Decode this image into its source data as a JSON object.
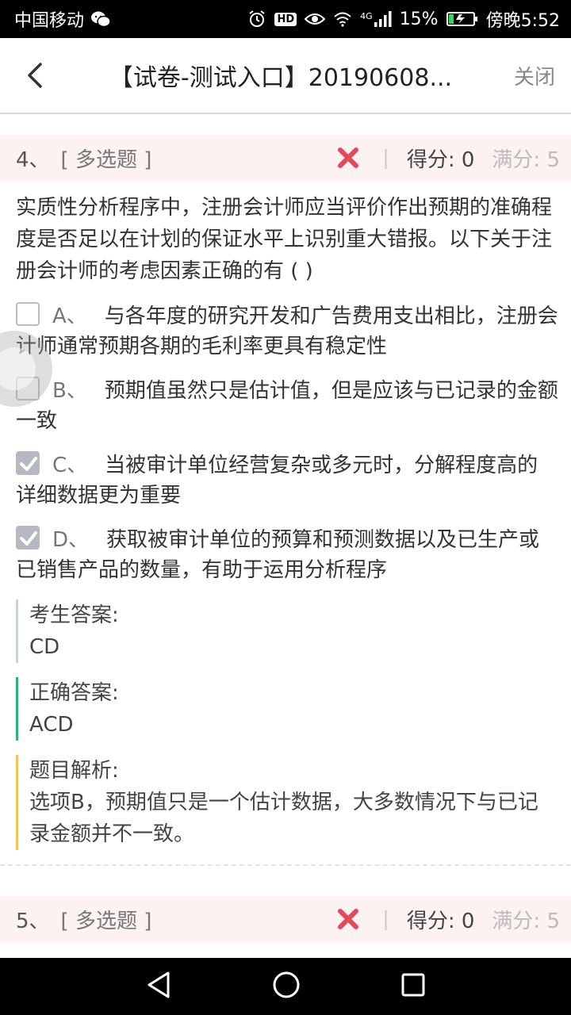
{
  "status_bar": {
    "carrier": "中国移动",
    "network": "4G",
    "battery": "15%",
    "time": "傍晚5:52",
    "hd_label": "HD"
  },
  "header": {
    "title": "【试卷-测试入口】20190608...",
    "close_label": "关闭"
  },
  "question": {
    "number": "4、",
    "type": "[ 多选题 ]",
    "separator": "|",
    "score": "得分: 0",
    "full": "满分: 5",
    "text": "实质性分析程序中，注册会计师应当评价作出预期的准确程度是否足以在计划的保证水平上识别重大错报。以下关于注册会计师的考虑因素正确的有 ( )",
    "options": [
      {
        "key": "A、",
        "text": "与各年度的研究开发和广告费用支出相比，注册会计师通常预期各期的毛利率更具有稳定性",
        "checked": false
      },
      {
        "key": "B、",
        "text": "预期值虽然只是估计值，但是应该与已记录的金额一致",
        "checked": false
      },
      {
        "key": "C、",
        "text": "当被审计单位经营复杂或多元时，分解程度高的详细数据更为重要",
        "checked": true
      },
      {
        "key": "D、",
        "text": "获取被审计单位的预算和预测数据以及已生产或已销售产品的数量，有助于运用分析程序",
        "checked": true
      }
    ],
    "student_answer_label": "考生答案:",
    "student_answer": "CD",
    "correct_answer_label": "正确答案:",
    "correct_answer": "ACD",
    "analysis_label": "题目解析:",
    "analysis": "选项B，预期值只是一个估计数据，大多数情况下与已记录金额并不一致。"
  },
  "next_question": {
    "number": "5、",
    "type": "[ 多选题 ]",
    "separator": "|",
    "score": "得分: 0",
    "full": "满分: 5"
  },
  "colors": {
    "wrong_mark": "#e24a55",
    "correct_bar": "#2db37f",
    "analysis_bar": "#f7c058",
    "student_bar": "#c9d3db"
  }
}
